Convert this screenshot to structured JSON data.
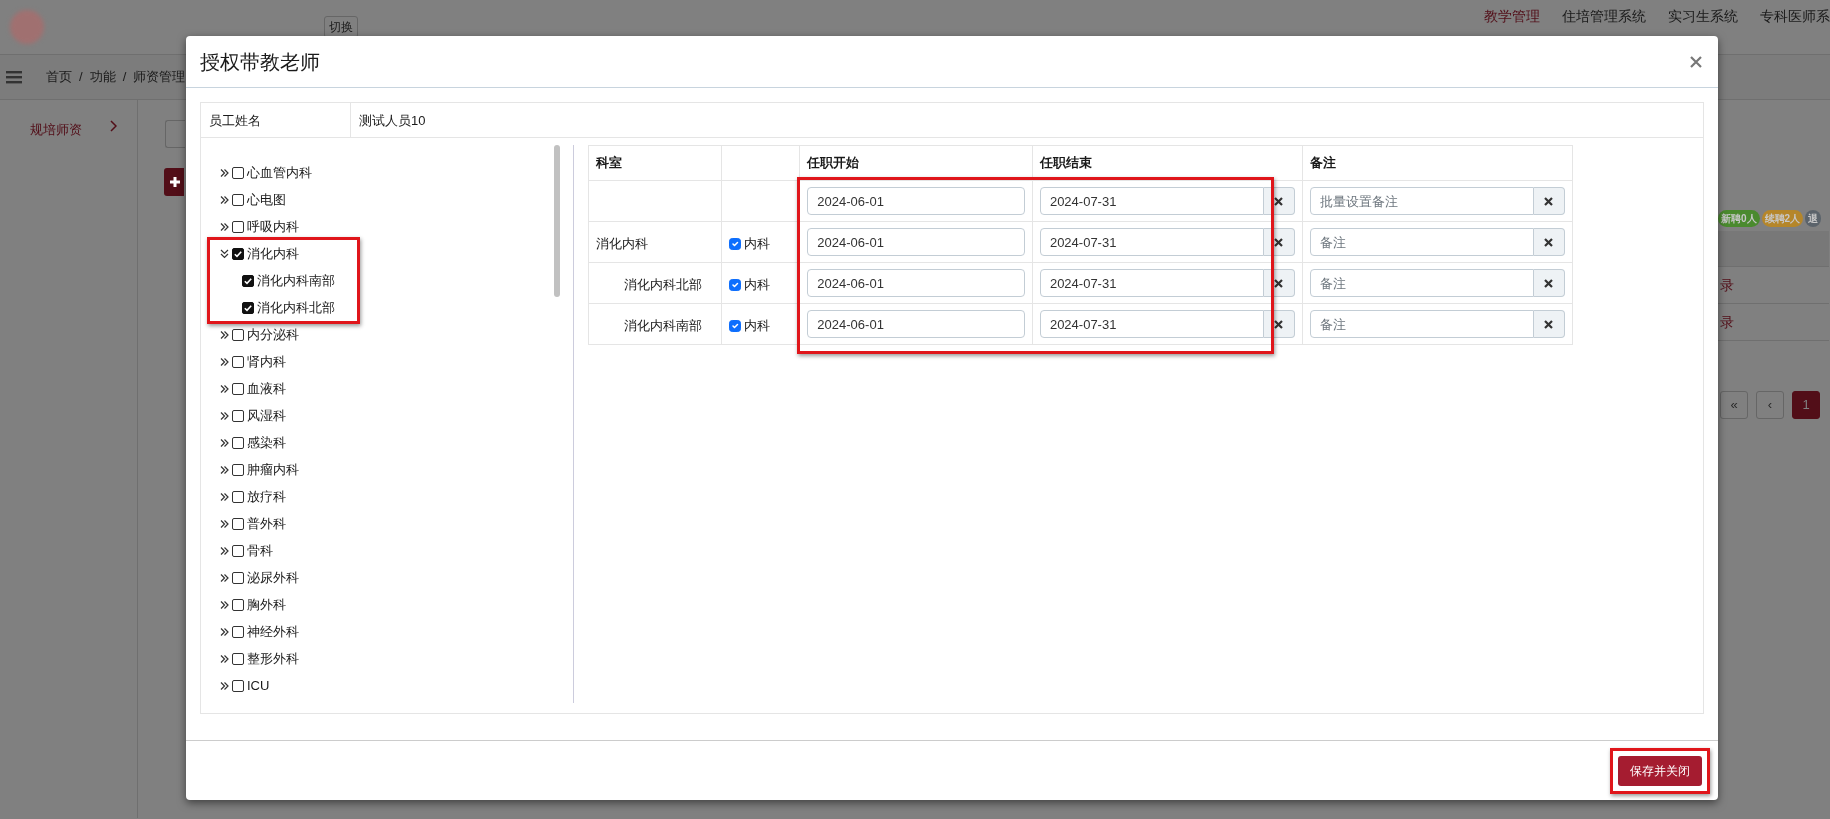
{
  "header": {
    "switch_button": "切换",
    "nav": [
      {
        "label": "教学管理",
        "selected": true
      },
      {
        "label": "住培管理系统",
        "selected": false
      },
      {
        "label": "实习生系统",
        "selected": false
      },
      {
        "label": "专科医师系",
        "selected": false
      }
    ]
  },
  "breadcrumb": [
    {
      "label": "首页"
    },
    {
      "separator": "/",
      "label": "功能"
    },
    {
      "separator": "/",
      "label": "师资管理"
    }
  ],
  "sidebar": {
    "items": [
      {
        "label": "规培师资",
        "selected": true
      }
    ]
  },
  "background": {
    "badges": [
      {
        "label": "新聘0人",
        "color": "#4a8a2e"
      },
      {
        "label": "续聘2人",
        "color": "#b5862a"
      },
      {
        "label": "退",
        "color": "#5b636b"
      }
    ],
    "links": [
      "录",
      "录"
    ],
    "pagination": [
      {
        "label": "«",
        "selected": false
      },
      {
        "label": "‹",
        "selected": false
      },
      {
        "label": "1",
        "selected": true
      }
    ]
  },
  "modal": {
    "title": "授权带教老师",
    "employee_label": "员工姓名",
    "employee_name": "测试人员10",
    "tree": [
      {
        "label": "心血管内科",
        "checked": false,
        "expanded": false,
        "highlighted": false
      },
      {
        "label": "心电图",
        "checked": false,
        "expanded": false,
        "highlighted": false
      },
      {
        "label": "呼吸内科",
        "checked": false,
        "expanded": false,
        "highlighted": false
      },
      {
        "label": "消化内科",
        "checked": true,
        "expanded": true,
        "highlighted": true,
        "children": [
          {
            "label": "消化内科南部",
            "checked": true
          },
          {
            "label": "消化内科北部",
            "checked": true
          }
        ]
      },
      {
        "label": "内分泌科",
        "checked": false,
        "expanded": false,
        "highlighted": false
      },
      {
        "label": "肾内科",
        "checked": false,
        "expanded": false,
        "highlighted": false
      },
      {
        "label": "血液科",
        "checked": false,
        "expanded": false,
        "highlighted": false
      },
      {
        "label": "风湿科",
        "checked": false,
        "expanded": false,
        "highlighted": false
      },
      {
        "label": "感染科",
        "checked": false,
        "expanded": false,
        "highlighted": false
      },
      {
        "label": "肿瘤内科",
        "checked": false,
        "expanded": false,
        "highlighted": false
      },
      {
        "label": "放疗科",
        "checked": false,
        "expanded": false,
        "highlighted": false
      },
      {
        "label": "普外科",
        "checked": false,
        "expanded": false,
        "highlighted": false
      },
      {
        "label": "骨科",
        "checked": false,
        "expanded": false,
        "highlighted": false
      },
      {
        "label": "泌尿外科",
        "checked": false,
        "expanded": false,
        "highlighted": false
      },
      {
        "label": "胸外科",
        "checked": false,
        "expanded": false,
        "highlighted": false
      },
      {
        "label": "神经外科",
        "checked": false,
        "expanded": false,
        "highlighted": false
      },
      {
        "label": "整形外科",
        "checked": false,
        "expanded": false,
        "highlighted": false
      },
      {
        "label": "ICU",
        "checked": false,
        "expanded": false,
        "highlighted": false
      }
    ],
    "table": {
      "columns": [
        {
          "label": "科室",
          "highlighted": false
        },
        {
          "kind": "blank",
          "highlighted": false
        },
        {
          "label": "任职开始",
          "highlighted": true
        },
        {
          "label": "任职结束",
          "highlighted": true
        },
        {
          "label": "备注",
          "highlighted": false
        }
      ],
      "rows": [
        {
          "kind": "batch",
          "start": "2024-06-01",
          "end": "2024-07-31",
          "note_placeholder": "批量设置备注"
        },
        {
          "kind": "department",
          "department": "消化内科",
          "checkbox_label": "内科",
          "checked": true,
          "start": "2024-06-01",
          "end": "2024-07-31",
          "note_placeholder": "备注",
          "children": [
            {
              "kind": "department",
              "department": "消化内科北部",
              "checkbox_label": "内科",
              "checked": true,
              "start": "2024-06-01",
              "end": "2024-07-31",
              "note_placeholder": "备注"
            },
            {
              "kind": "department",
              "department": "消化内科南部",
              "checkbox_label": "内科",
              "checked": true,
              "start": "2024-06-01",
              "end": "2024-07-31",
              "note_placeholder": "备注"
            }
          ]
        }
      ]
    },
    "save_button": {
      "label": "保存并关闭",
      "highlighted": true
    }
  }
}
